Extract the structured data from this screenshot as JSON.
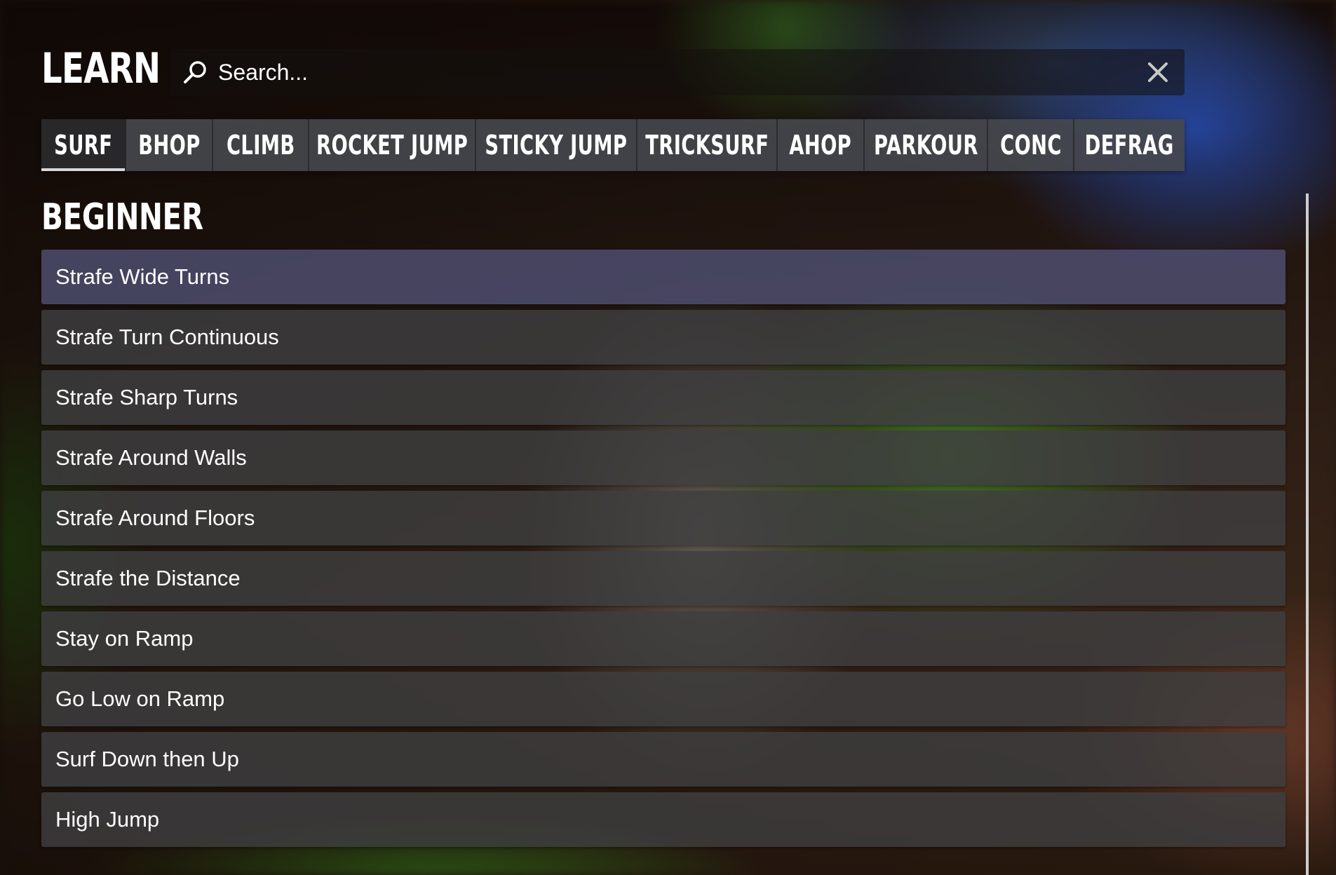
{
  "header": {
    "title": "LEARN",
    "search": {
      "placeholder": "Search...",
      "value": "",
      "search_icon": "search-icon",
      "clear_icon": "close-icon"
    }
  },
  "tabs": [
    {
      "label": "SURF",
      "active": true
    },
    {
      "label": "BHOP",
      "active": false
    },
    {
      "label": "CLIMB",
      "active": false
    },
    {
      "label": "ROCKET JUMP",
      "active": false
    },
    {
      "label": "STICKY JUMP",
      "active": false
    },
    {
      "label": "TRICKSURF",
      "active": false
    },
    {
      "label": "AHOP",
      "active": false
    },
    {
      "label": "PARKOUR",
      "active": false
    },
    {
      "label": "CONC",
      "active": false
    },
    {
      "label": "DEFRAG",
      "active": false
    }
  ],
  "section": {
    "title": "BEGINNER",
    "lessons": [
      {
        "label": "Strafe Wide Turns"
      },
      {
        "label": "Strafe Turn Continuous"
      },
      {
        "label": "Strafe Sharp Turns"
      },
      {
        "label": "Strafe Around Walls"
      },
      {
        "label": "Strafe Around Floors"
      },
      {
        "label": "Strafe the Distance"
      },
      {
        "label": "Stay on Ramp"
      },
      {
        "label": "Go Low on Ramp"
      },
      {
        "label": "Surf Down then Up"
      },
      {
        "label": "High Jump"
      }
    ]
  },
  "colors": {
    "text": "#ffffff",
    "tab_active_underline": "#d9d9d9",
    "row_background": "#3e3e40"
  }
}
